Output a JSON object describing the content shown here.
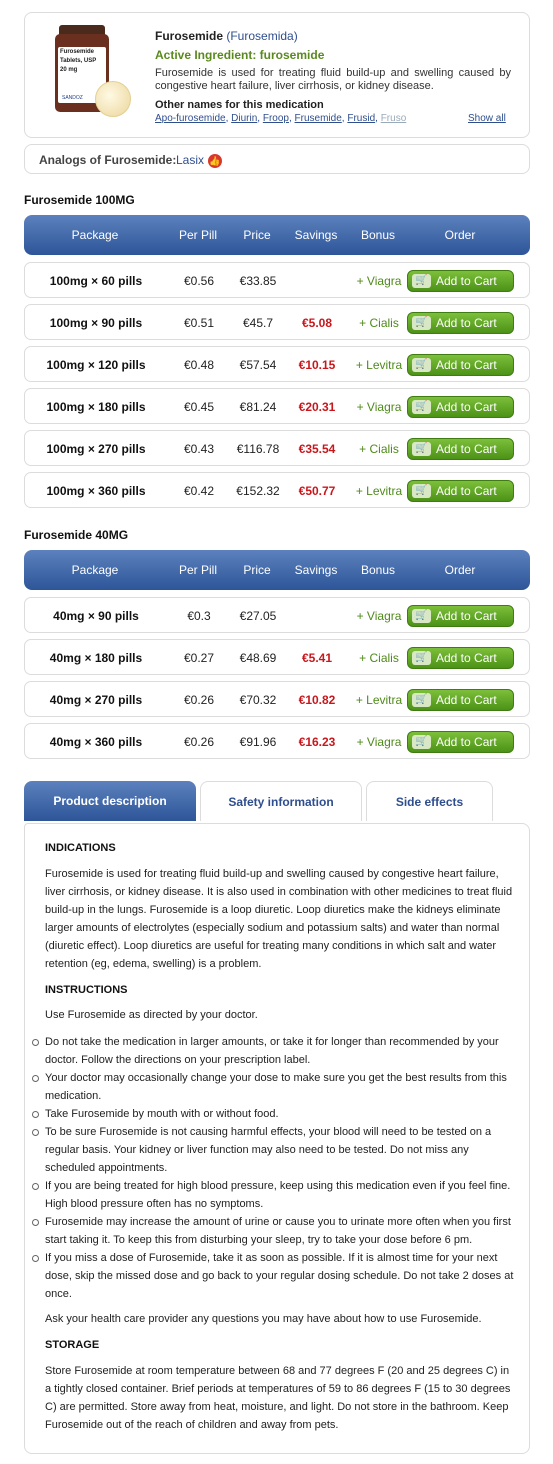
{
  "product": {
    "name": "Furosemide",
    "latin_name": "(Furosemida)",
    "active_ingredient": "Active Ingredient: furosemide",
    "description": "Furosemide is used for treating fluid build-up and swelling caused by congestive heart failure, liver cirrhosis, or kidney disease.",
    "other_names_title": "Other names for this medication",
    "other_names": [
      "Apo-furosemide",
      "Diurin",
      "Froop",
      "Frusemide",
      "Frusid",
      "Fruso"
    ],
    "show_all": "Show all",
    "bottle_label": [
      "Furosemide",
      "Tablets, USP",
      "20 mg"
    ],
    "bottle_brand": "SANDOZ"
  },
  "analogs": {
    "label": "Analogs of Furosemide:",
    "link": "Lasix",
    "icon": "thumbs-up-icon"
  },
  "tables": [
    {
      "title": "Furosemide 100MG",
      "headers": [
        "Package",
        "Per Pill",
        "Price",
        "Savings",
        "Bonus",
        "Order"
      ],
      "rows": [
        {
          "package": "100mg × 60 pills",
          "per_pill": "€0.56",
          "price": "€33.85",
          "savings": "",
          "bonus": "+ Viagra",
          "order": "Add to Cart"
        },
        {
          "package": "100mg × 90 pills",
          "per_pill": "€0.51",
          "price": "€45.7",
          "savings": "€5.08",
          "bonus": "+ Cialis",
          "order": "Add to Cart"
        },
        {
          "package": "100mg × 120 pills",
          "per_pill": "€0.48",
          "price": "€57.54",
          "savings": "€10.15",
          "bonus": "+ Levitra",
          "order": "Add to Cart"
        },
        {
          "package": "100mg × 180 pills",
          "per_pill": "€0.45",
          "price": "€81.24",
          "savings": "€20.31",
          "bonus": "+ Viagra",
          "order": "Add to Cart"
        },
        {
          "package": "100mg × 270 pills",
          "per_pill": "€0.43",
          "price": "€116.78",
          "savings": "€35.54",
          "bonus": "+ Cialis",
          "order": "Add to Cart"
        },
        {
          "package": "100mg × 360 pills",
          "per_pill": "€0.42",
          "price": "€152.32",
          "savings": "€50.77",
          "bonus": "+ Levitra",
          "order": "Add to Cart"
        }
      ]
    },
    {
      "title": "Furosemide 40MG",
      "headers": [
        "Package",
        "Per Pill",
        "Price",
        "Savings",
        "Bonus",
        "Order"
      ],
      "rows": [
        {
          "package": "40mg × 90 pills",
          "per_pill": "€0.3",
          "price": "€27.05",
          "savings": "",
          "bonus": "+ Viagra",
          "order": "Add to Cart"
        },
        {
          "package": "40mg × 180 pills",
          "per_pill": "€0.27",
          "price": "€48.69",
          "savings": "€5.41",
          "bonus": "+ Cialis",
          "order": "Add to Cart"
        },
        {
          "package": "40mg × 270 pills",
          "per_pill": "€0.26",
          "price": "€70.32",
          "savings": "€10.82",
          "bonus": "+ Levitra",
          "order": "Add to Cart"
        },
        {
          "package": "40mg × 360 pills",
          "per_pill": "€0.26",
          "price": "€91.96",
          "savings": "€16.23",
          "bonus": "+ Viagra",
          "order": "Add to Cart"
        }
      ]
    }
  ],
  "tabs": [
    "Product description",
    "Safety information",
    "Side effects"
  ],
  "description": {
    "indications_title": "INDICATIONS",
    "indications_text": "Furosemide is used for treating fluid build-up and swelling caused by congestive heart failure, liver cirrhosis, or kidney disease. It is also used in combination with other medicines to treat fluid build-up in the lungs. Furosemide is a loop diuretic. Loop diuretics make the kidneys eliminate larger amounts of electrolytes (especially sodium and potassium salts) and water than normal (diuretic effect). Loop diuretics are useful for treating many conditions in which salt and water retention (eg, edema, swelling) is a problem.",
    "instructions_title": "INSTRUCTIONS",
    "instructions_intro": "Use Furosemide as directed by your doctor.",
    "instructions_list": [
      "Do not take the medication in larger amounts, or take it for longer than recommended by your doctor. Follow the directions on your prescription label.",
      "Your doctor may occasionally change your dose to make sure you get the best results from this medication.",
      "Take Furosemide by mouth with or without food.",
      "To be sure Furosemide is not causing harmful effects, your blood will need to be tested on a regular basis. Your kidney or liver function may also need to be tested. Do not miss any scheduled appointments.",
      "If you are being treated for high blood pressure, keep using this medication even if you feel fine. High blood pressure often has no symptoms.",
      "Furosemide may increase the amount of urine or cause you to urinate more often when you first start taking it. To keep this from disturbing your sleep, try to take your dose before 6 pm.",
      "If you miss a dose of Furosemide, take it as soon as possible. If it is almost time for your next dose, skip the missed dose and go back to your regular dosing schedule. Do not take 2 doses at once."
    ],
    "instructions_outro": "Ask your health care provider any questions you may have about how to use Furosemide.",
    "storage_title": "STORAGE",
    "storage_text": "Store Furosemide at room temperature between 68 and 77 degrees F (20 and 25 degrees C) in a tightly closed container. Brief periods at temperatures of 59 to 86 degrees F (15 to 30 degrees C) are permitted. Store away from heat, moisture, and light. Do not store in the bathroom. Keep Furosemide out of the reach of children and away from pets."
  },
  "colors": {
    "header_blue": "#2d5598",
    "link_blue": "#2f4e8e",
    "accent_green": "#5a8a1e",
    "savings_red": "#c8171c",
    "cart_green": "#4c9217"
  }
}
